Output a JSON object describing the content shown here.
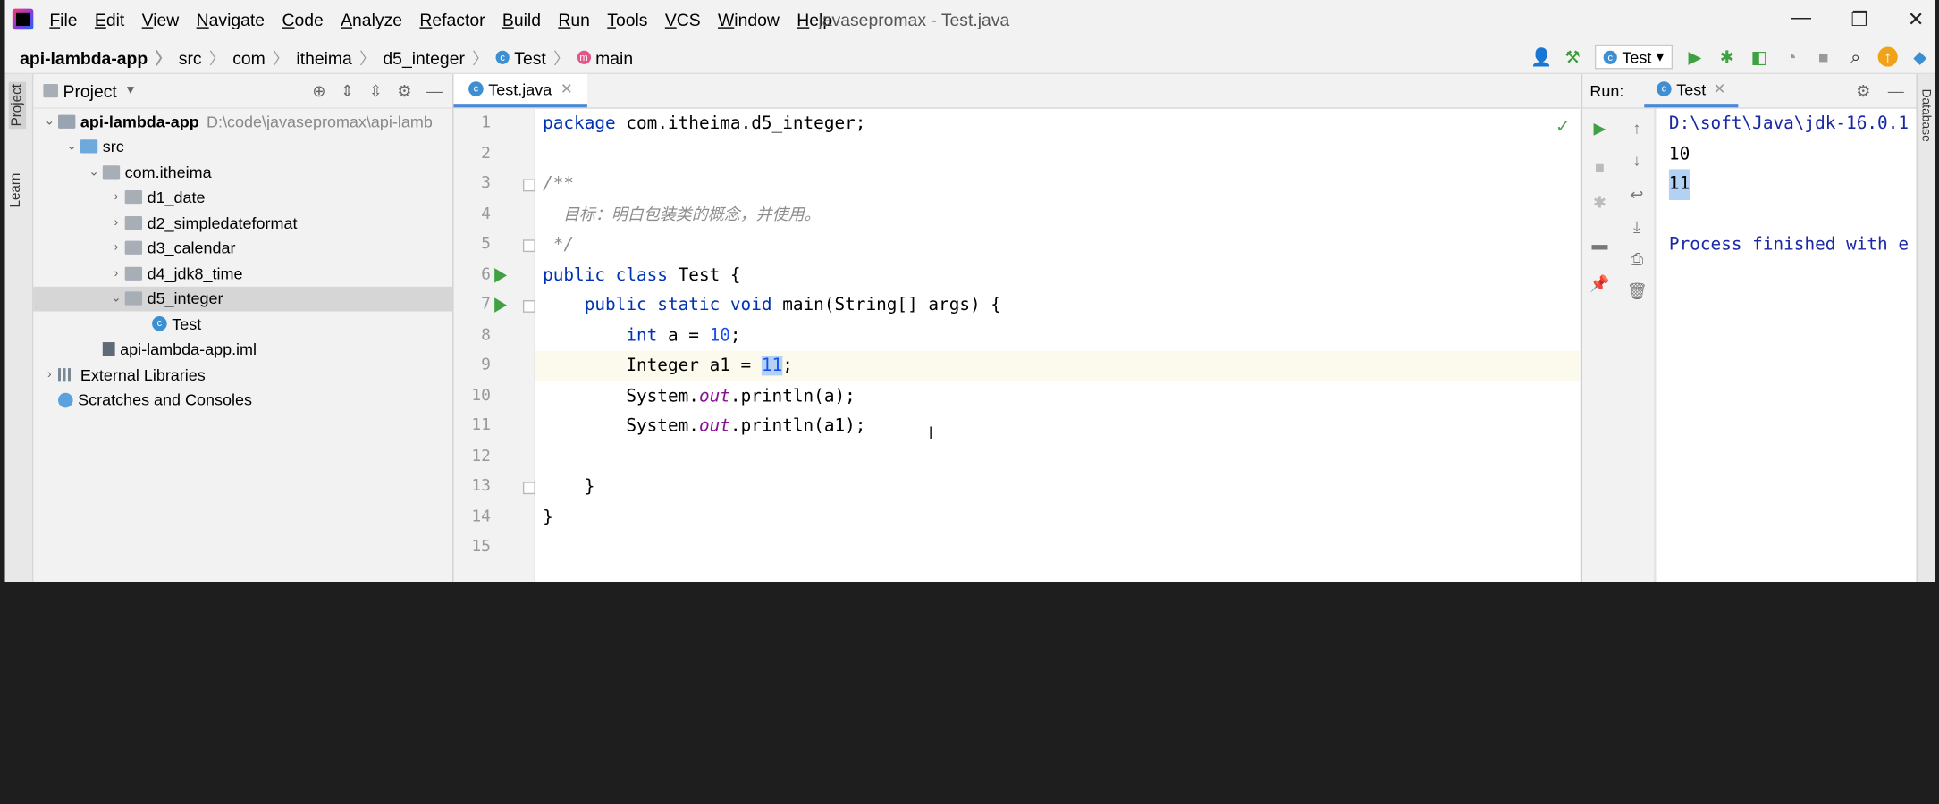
{
  "window": {
    "title": "javasepromax - Test.java",
    "controls": [
      "—",
      "❐",
      "✕"
    ]
  },
  "menu": [
    "File",
    "Edit",
    "View",
    "Navigate",
    "Code",
    "Analyze",
    "Refactor",
    "Build",
    "Run",
    "Tools",
    "VCS",
    "Window",
    "Help"
  ],
  "breadcrumb": [
    "api-lambda-app",
    "src",
    "com",
    "itheima",
    "d5_integer",
    "Test",
    "main"
  ],
  "toolbar": {
    "run_config": "Test"
  },
  "left_strip": {
    "project": "Project",
    "learn": "Learn"
  },
  "project_panel": {
    "title": "Project",
    "tree": [
      {
        "label": "api-lambda-app",
        "path": "D:\\code\\javasepromax\\api-lamb",
        "arrow": "⌄"
      },
      {
        "label": "src",
        "arrow": "⌄"
      },
      {
        "label": "com.itheima",
        "arrow": "⌄"
      },
      {
        "label": "d1_date",
        "arrow": "›"
      },
      {
        "label": "d2_simpledateformat",
        "arrow": "›"
      },
      {
        "label": "d3_calendar",
        "arrow": "›"
      },
      {
        "label": "d4_jdk8_time",
        "arrow": "›"
      },
      {
        "label": "d5_integer",
        "arrow": "⌄"
      },
      {
        "label": "Test"
      },
      {
        "label": "api-lambda-app.iml"
      },
      {
        "label": "External Libraries",
        "arrow": "›"
      },
      {
        "label": "Scratches and Consoles"
      }
    ]
  },
  "editor": {
    "tab": "Test.java",
    "lines": [
      {
        "n": "1"
      },
      {
        "n": "2"
      },
      {
        "n": "3"
      },
      {
        "n": "4"
      },
      {
        "n": "5"
      },
      {
        "n": "6"
      },
      {
        "n": "7"
      },
      {
        "n": "8"
      },
      {
        "n": "9"
      },
      {
        "n": "10"
      },
      {
        "n": "11"
      },
      {
        "n": "12"
      },
      {
        "n": "13"
      },
      {
        "n": "14"
      },
      {
        "n": "15"
      }
    ],
    "code": {
      "l1_kw": "package",
      "l1_rest": " com.itheima.d5_integer;",
      "l3": "/**",
      "l4": "    目标：明白包装类的概念，并使用。",
      "l5": " */",
      "l6_kw": "public class",
      "l6_rest": " Test {",
      "l7_kw": "    public static void",
      "l7_rest": " main(String[] args) {",
      "l8_kw": "        int",
      "l8_mid": " a = ",
      "l8_num": "10",
      "l8_end": ";",
      "l9_pre": "        Integer a1 = ",
      "l9_num": "11",
      "l9_end": ";",
      "l10_pre": "        System.",
      "l10_field": "out",
      "l10_end": ".println(a);",
      "l11_pre": "        System.",
      "l11_field": "out",
      "l11_end": ".println(a1);",
      "l13": "    }",
      "l14": "}"
    }
  },
  "run_panel": {
    "label": "Run:",
    "tab": "Test",
    "console": [
      "D:\\soft\\Java\\jdk-16.0.1",
      "10",
      "11",
      "",
      "Process finished with e"
    ]
  },
  "right_strip": {
    "database": "Database"
  }
}
